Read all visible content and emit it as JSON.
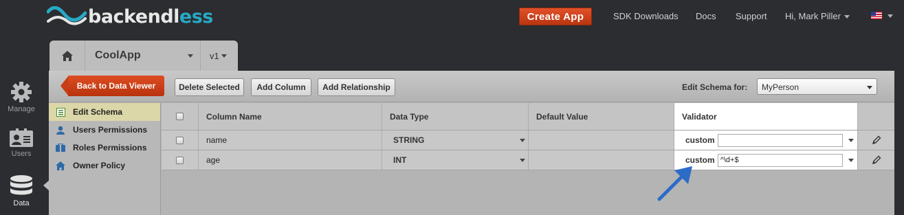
{
  "header": {
    "logo_text": "backendless",
    "create_app": "Create App",
    "links": [
      "SDK Downloads",
      "Docs",
      "Support"
    ],
    "user": "Hi, Mark Piller"
  },
  "app_tabs": {
    "app_name": "CoolApp",
    "version": "v1"
  },
  "left_nav": [
    {
      "label": "Manage",
      "icon": "gear-icon"
    },
    {
      "label": "Users",
      "icon": "users-icon"
    },
    {
      "label": "Data",
      "icon": "database-icon"
    }
  ],
  "toolbar": {
    "back": "Back to Data Viewer",
    "delete_selected": "Delete Selected",
    "add_column": "Add Column",
    "add_relationship": "Add Relationship",
    "edit_schema_for": "Edit Schema for:",
    "table_selected": "MyPerson"
  },
  "menu": [
    {
      "label": "Edit Schema",
      "icon": "schema-icon"
    },
    {
      "label": "Users Permissions",
      "icon": "user-icon"
    },
    {
      "label": "Roles Permissions",
      "icon": "roles-icon"
    },
    {
      "label": "Owner Policy",
      "icon": "home-icon"
    }
  ],
  "table": {
    "headers": {
      "column_name": "Column Name",
      "data_type": "Data Type",
      "default_value": "Default Value",
      "validator": "Validator"
    },
    "rows": [
      {
        "name": "name",
        "type": "STRING",
        "default": "",
        "validator_type": "custom",
        "validator_value": ""
      },
      {
        "name": "age",
        "type": "INT",
        "default": "",
        "validator_type": "custom",
        "validator_value": "^\\d+$"
      }
    ]
  },
  "colors": {
    "accent": "#c63d16",
    "brand_teal": "#27a9c5",
    "annotation_arrow": "#2c6cc7"
  }
}
